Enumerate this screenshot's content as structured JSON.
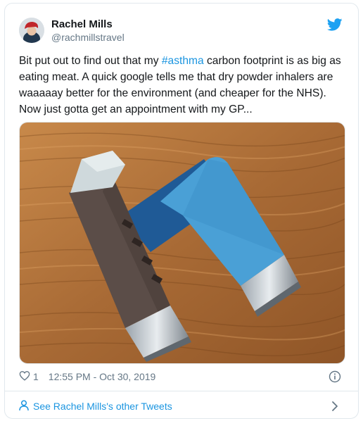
{
  "tweet": {
    "author_name": "Rachel Mills",
    "author_handle": "@rachmillstravel",
    "text_before_tag": "Bit put out to find out that my ",
    "hashtag": "#asthma",
    "text_after_tag": " carbon footprint is as big as eating meat. A quick google tells me that dry powder inhalers are waaaaay better for the environment (and cheaper for the NHS). Now just gotta get an appointment with my GP...",
    "like_count": "1",
    "timestamp": "12:55 PM - Oct 30, 2019"
  },
  "footer": {
    "see_more_label": "See Rachel Mills's other Tweets"
  },
  "icons": {
    "brand": "twitter-bird-icon",
    "like": "heart-outline-icon",
    "info": "info-circle-icon",
    "person": "person-outline-icon",
    "chevron": "chevron-right-icon"
  },
  "colors": {
    "accent": "#1b95e0",
    "text": "#14171a",
    "secondary": "#657786",
    "border": "#e1e8ed"
  }
}
